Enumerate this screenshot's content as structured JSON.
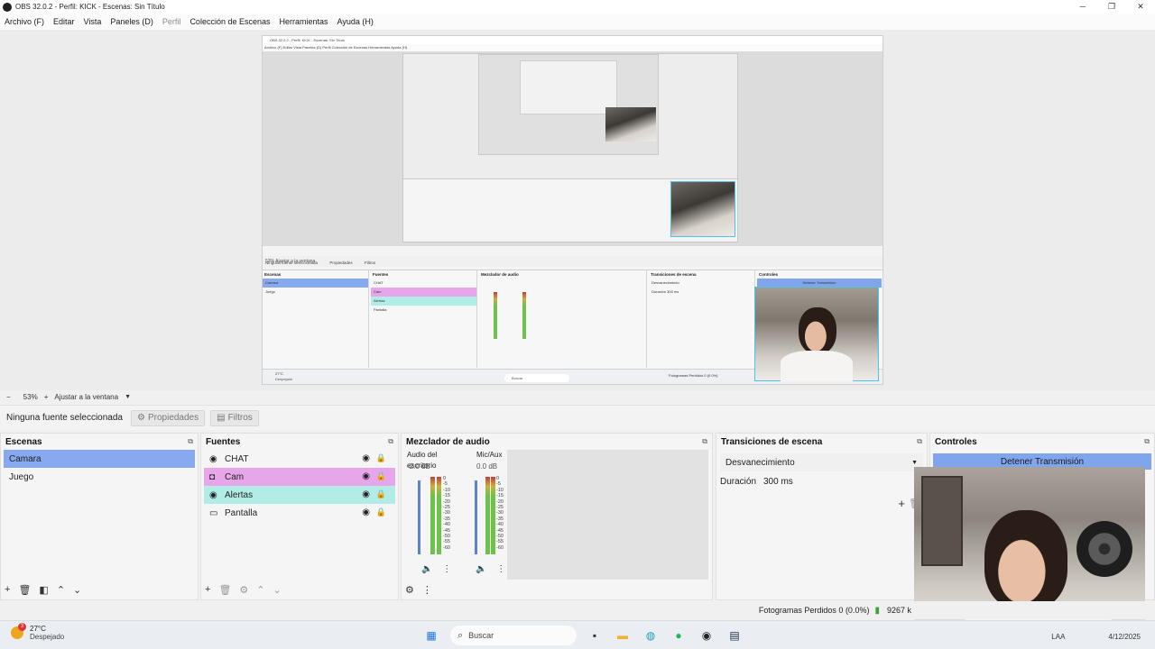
{
  "window": {
    "title": "OBS 32.0.2 - Perfil: KICK - Escenas: Sin Título",
    "buttons": [
      "─",
      "❐",
      "✕"
    ]
  },
  "menu": [
    "Archivo (F)",
    "Editar",
    "Vista",
    "Paneles (D)",
    "Perfil",
    "Colección de Escenas",
    "Herramientas",
    "Ayuda (H)"
  ],
  "zoom": {
    "minus": "−",
    "level": "53%",
    "plus": "+",
    "fit": "Ajustar a la ventana"
  },
  "source_toolbar": {
    "no_source": "Ninguna fuente seleccionada",
    "properties": "Propiedades",
    "filters": "Filtros"
  },
  "scenes": {
    "title": "Escenas",
    "items": [
      "Camara",
      "Juego"
    ]
  },
  "sources": {
    "title": "Fuentes",
    "items": [
      "CHAT",
      "Cam",
      "Alertas",
      "Pantalla"
    ]
  },
  "mixer": {
    "title": "Mezclador de audio",
    "channels": [
      {
        "name": "Audio del escritorio",
        "db": "-2.0 dB"
      },
      {
        "name": "Mic/Aux",
        "db": "0.0 dB"
      }
    ],
    "scale": [
      "0",
      "-5",
      "-10",
      "-15",
      "-20",
      "-25",
      "-30",
      "-35",
      "-40",
      "-45",
      "-50",
      "-55",
      "-60"
    ]
  },
  "transitions": {
    "title": "Transiciones de escena",
    "selected": "Desvanecimiento",
    "duration_label": "Duración",
    "duration_value": "300 ms"
  },
  "controls": {
    "title": "Controles",
    "stop_stream": "Detener Transmisión"
  },
  "status": {
    "dropped_frames": "Fotogramas Perdidos 0 (0.0%)",
    "bitrate": "9267 k"
  },
  "taskbar": {
    "weather_temp": "27°C",
    "weather_desc": "Despejado",
    "weather_badge": "3",
    "search": "Buscar",
    "lang": "LAA",
    "date": "4/12/2025"
  },
  "nested": {
    "title": "OBS 32.0.2 - Perfil: KICK - Escenas: Sin Título",
    "menu": "Archivo (F)   Editar   Vista   Paneles (D)   Perfil   Colección de Escenas   Herramientas   Ayuda (H)",
    "zoom": "53%     Ajustar a la ventana",
    "no_source": "Ninguna fuente seleccionada",
    "properties": "Propiedades",
    "filters": "Filtros",
    "scenes_title": "Escenas",
    "sources_title": "Fuentes",
    "mixer_title": "Mezclador de audio",
    "transitions_title": "Transiciones de escena",
    "controls_title": "Controles",
    "stop_stream": "Detener Transmisión",
    "transition": "Desvanecimiento",
    "duration_label": "Duración",
    "duration_value": "300 ms",
    "status": "Fotogramas Perdidos 0 (0.0%)",
    "weather_temp": "27°C",
    "weather_desc": "Despejado",
    "search": "Buscar"
  },
  "colors": {
    "scene_selected": "#86a9f0",
    "cam_row": "#e8a6ea",
    "alertas_row": "#b2ece6",
    "stop_button": "#7fa6ec",
    "meter_green": "#6cc24a"
  }
}
